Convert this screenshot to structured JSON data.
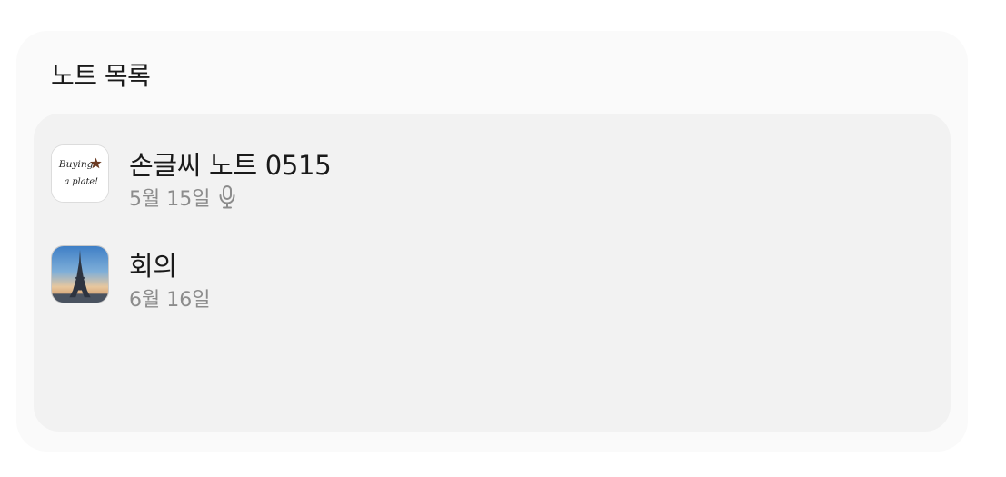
{
  "panel": {
    "title": "노트 목록"
  },
  "notes": [
    {
      "title": "손글씨 노트 0515",
      "date": "5월 15일",
      "has_voice": true,
      "thumbnail": "handwriting-thumbnail",
      "thumbnail_text": [
        "Buying",
        "a plate!"
      ]
    },
    {
      "title": "회의",
      "date": "6월 16일",
      "has_voice": false,
      "thumbnail": "eiffel-tower-photo"
    }
  ],
  "icons": {
    "voice": "microphone-icon"
  },
  "colors": {
    "card_bg": "#fafafa",
    "list_bg": "#f2f2f2",
    "title_text": "#1a1a1a",
    "meta_text": "#8c8c8c"
  }
}
